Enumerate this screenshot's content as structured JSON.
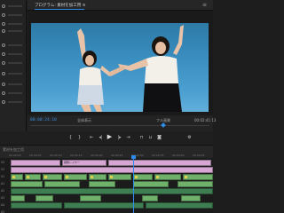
{
  "monitor": {
    "tab_label": "プログラム: 素材を加工用 ≡",
    "timecode": "00:00:24:10",
    "fit": "全体表示",
    "quality": "フル画質",
    "end_timecode": "00:02:41:13"
  },
  "timeline": {
    "label": "素材を加工用",
    "ruler_ticks": [
      "00:00:00",
      "00:00:05",
      "00:00:10",
      "00:00:15",
      "00:00:20",
      "00:00:25",
      "00:00:30",
      "00:00:35",
      "00:00:40",
      "00:00:45"
    ],
    "tracks": [
      {
        "label": "V3"
      },
      {
        "label": "V2"
      },
      {
        "label": "V1"
      },
      {
        "label": "A1"
      },
      {
        "label": "A2"
      },
      {
        "label": "A3"
      },
      {
        "label": "A4"
      },
      {
        "label": "A5"
      }
    ],
    "clips": {
      "v3_title": "調整レイヤー"
    }
  },
  "icons": {
    "menu": "hamburger-menu-icon",
    "play": "play-icon",
    "step_back": "step-back-icon",
    "step_forward": "step-forward-icon",
    "mark_in": "mark-in-icon",
    "mark_out": "mark-out-icon",
    "camera": "export-frame-icon"
  },
  "colors": {
    "accent": "#2d8ceb",
    "clip_pink": "#d6a7d2",
    "clip_green": "#6fb06b",
    "clip_dark_green": "#3f7d52"
  }
}
